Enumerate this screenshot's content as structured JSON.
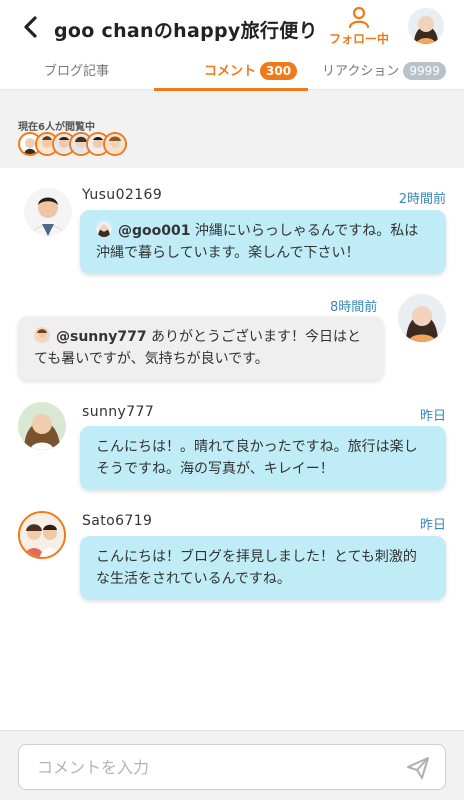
{
  "header": {
    "title": "goo chanのhappy旅行便り",
    "follow_label": "フォロー中",
    "icons": {
      "back": "chevron-left-icon",
      "follow": "person-icon"
    }
  },
  "tabs": [
    {
      "label": "ブログ記事",
      "badge": null
    },
    {
      "label": "コメント",
      "badge": "300"
    },
    {
      "label": "リアクション",
      "badge": "9999"
    }
  ],
  "viewers": {
    "label": "現在6人が閲覧中",
    "count": 6
  },
  "comments": [
    {
      "user": "Yusu02169",
      "time": "2時間前",
      "mention": "@goo001",
      "text": " 沖縄にいらっしゃるんですね。私は沖縄で暮らしています。楽しんで下さい！",
      "side": "left"
    },
    {
      "user": "",
      "time": "8時間前",
      "mention": "@sunny777",
      "text": " ありがとうございます！今日はとても暑いですが、気持ちが良いです。",
      "side": "right"
    },
    {
      "user": "sunny777",
      "time": "昨日",
      "mention": "",
      "text": "こんにちは！。晴れて良かったですね。旅行は楽しそうですね。海の写真が、キレイー！",
      "side": "left"
    },
    {
      "user": "Sato6719",
      "time": "昨日",
      "mention": "",
      "text": "こんにちは！ブログを拝見しました！とても刺激的な生活をされているんですね。",
      "side": "left"
    }
  ],
  "composer": {
    "placeholder": "コメントを入力",
    "value": ""
  },
  "colors": {
    "accent": "#f07a1a",
    "bubble_blue": "#bfecf6",
    "bubble_gray": "#efefef",
    "time_blue": "#3a88b8"
  }
}
